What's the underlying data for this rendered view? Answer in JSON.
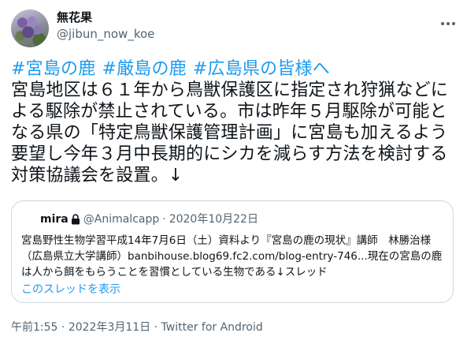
{
  "author": {
    "display_name": "無花果",
    "handle": "@jibun_now_koe"
  },
  "tweet": {
    "hashtags": [
      "#宮島の鹿",
      "#厳島の鹿",
      "#広島県の皆様へ"
    ],
    "body": "宮島地区は６１年から鳥獣保護区に指定され狩猟などによる駆除が禁止されている。市は昨年５月駆除が可能となる県の「特定鳥獣保護管理計画」に宮島も加えるよう要望し今年３月中長期的にシカを減らす方法を検討する対策協議会を設置。↓"
  },
  "quote": {
    "name": "mira",
    "handle": "@Animalcapp",
    "separator": "·",
    "date": "2020年10月22日",
    "text": "宮島野性生物学習平成14年7月6日（土）資料より『宮島の鹿の現状』講師　林勝治様（広島県立大学講師）banbihouse.blog69.fc2.com/blog-entry-746...現在の宮島の鹿は人から餌をもらうことを習慣としている生物である↓スレッド",
    "thread_link": "このスレッドを表示"
  },
  "meta": {
    "time": "午前1:55",
    "separator": " · ",
    "date": "2022年3月11日",
    "separator2": " · ",
    "source": "Twitter for Android"
  },
  "colors": {
    "link": "#1d9bf0",
    "secondary_text": "#536471",
    "border": "#cfd9de"
  },
  "icons": {
    "more": "more-horizontal-icon",
    "lock": "lock-icon"
  }
}
